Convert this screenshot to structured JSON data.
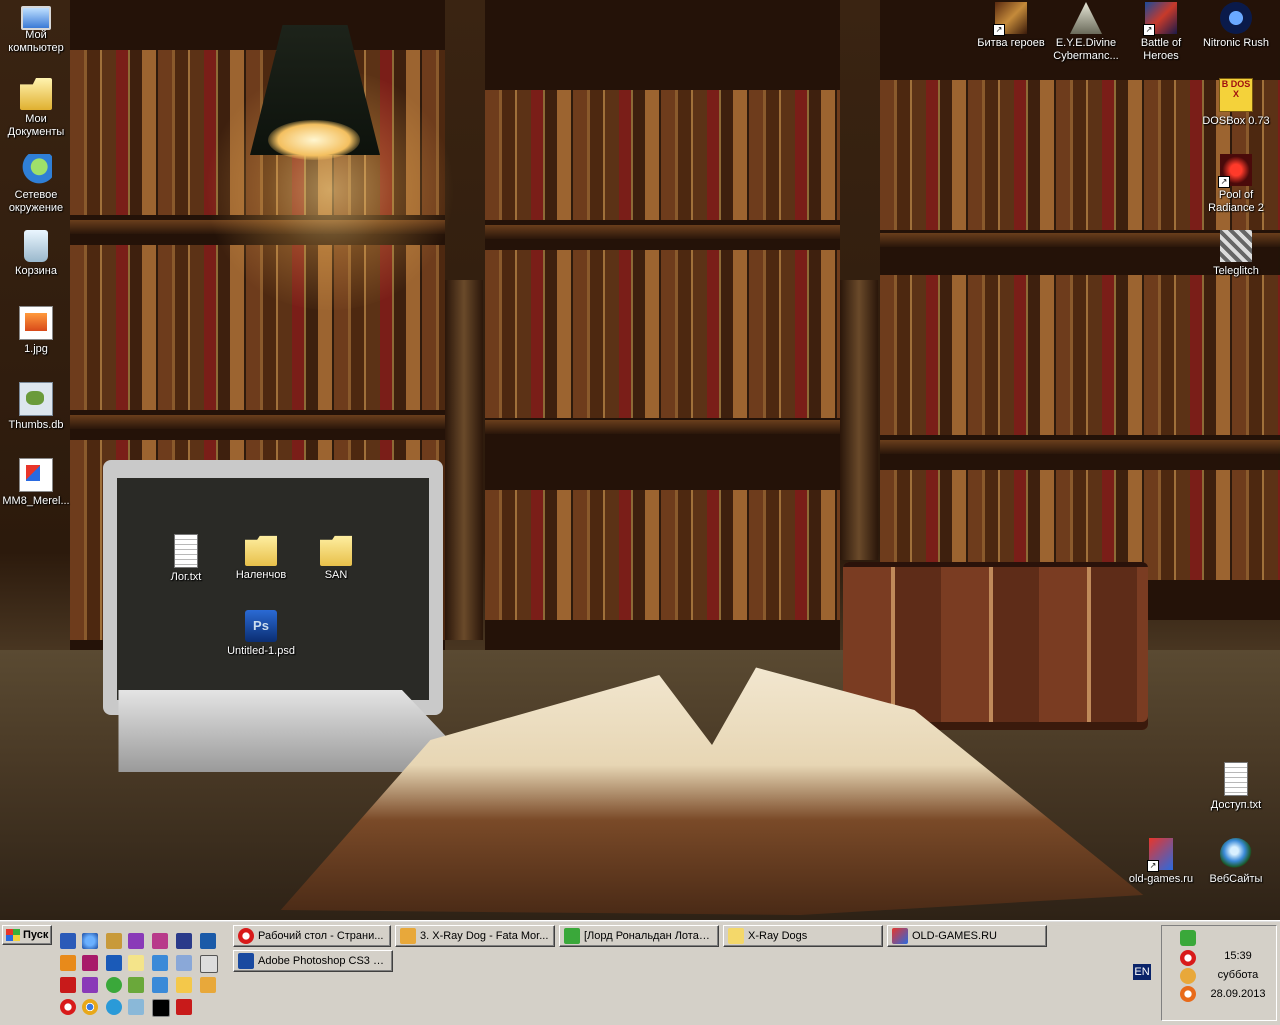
{
  "desktop_icons_left": [
    {
      "label": "Мой компьютер",
      "icon": "my-computer-icon"
    },
    {
      "label": "Мои Документы",
      "icon": "my-documents-icon"
    },
    {
      "label": "Сетевое окружение",
      "icon": "network-icon"
    },
    {
      "label": "Корзина",
      "icon": "recycle-bin-icon"
    },
    {
      "label": "1.jpg",
      "icon": "image-file-icon"
    },
    {
      "label": "Thumbs.db",
      "icon": "db-file-icon"
    },
    {
      "label": "MM8_Merel...",
      "icon": "file-icon"
    }
  ],
  "desktop_icons_laptop": [
    {
      "label": "Лог.txt",
      "icon": "text-file-icon"
    },
    {
      "label": "Наленчов",
      "icon": "folder-icon"
    },
    {
      "label": "SAN",
      "icon": "folder-icon"
    },
    {
      "label": "Untitled-1.psd",
      "icon": "psd-file-icon"
    }
  ],
  "desktop_icons_right": [
    {
      "label": "Битва героев",
      "icon": "game-shortcut-icon"
    },
    {
      "label": "E.Y.E.Divine Cybermanc...",
      "icon": "game-shortcut-icon"
    },
    {
      "label": "Battle of Heroes",
      "icon": "game-shortcut-icon"
    },
    {
      "label": "Nitronic Rush",
      "icon": "game-shortcut-icon"
    },
    {
      "label": "DOSBox 0.73",
      "icon": "dosbox-icon",
      "glyph": "B DOS X"
    },
    {
      "label": "Pool of Radiance 2",
      "icon": "game-shortcut-icon"
    },
    {
      "label": "Teleglitch",
      "icon": "game-shortcut-icon"
    },
    {
      "label": "Доступ.txt",
      "icon": "text-file-icon"
    },
    {
      "label": "old-games.ru",
      "icon": "web-shortcut-icon"
    },
    {
      "label": "ВебСайты",
      "icon": "globe-icon"
    }
  ],
  "taskbar": {
    "start_label": "Пуск",
    "tasks": [
      {
        "label": "Рабочий стол - Страни...",
        "icon": "opera-icon"
      },
      {
        "label": "3. X-Ray Dog - Fata Mor...",
        "icon": "winamp-icon"
      },
      {
        "label": "[Лорд Рональдан Лотар]...",
        "icon": "notepad-icon"
      },
      {
        "label": "X-Ray Dogs",
        "icon": "folder-icon"
      },
      {
        "label": "OLD-GAMES.RU",
        "icon": "browser-icon"
      },
      {
        "label": "Adobe Photoshop CS3 E...",
        "icon": "photoshop-icon"
      }
    ],
    "language": "EN"
  },
  "tray": {
    "time": "15:39",
    "day": "суббота",
    "date": "28.09.2013"
  },
  "colors": {
    "taskbar_bg": "#d4d0c8",
    "active_caption": "#0a246a"
  }
}
